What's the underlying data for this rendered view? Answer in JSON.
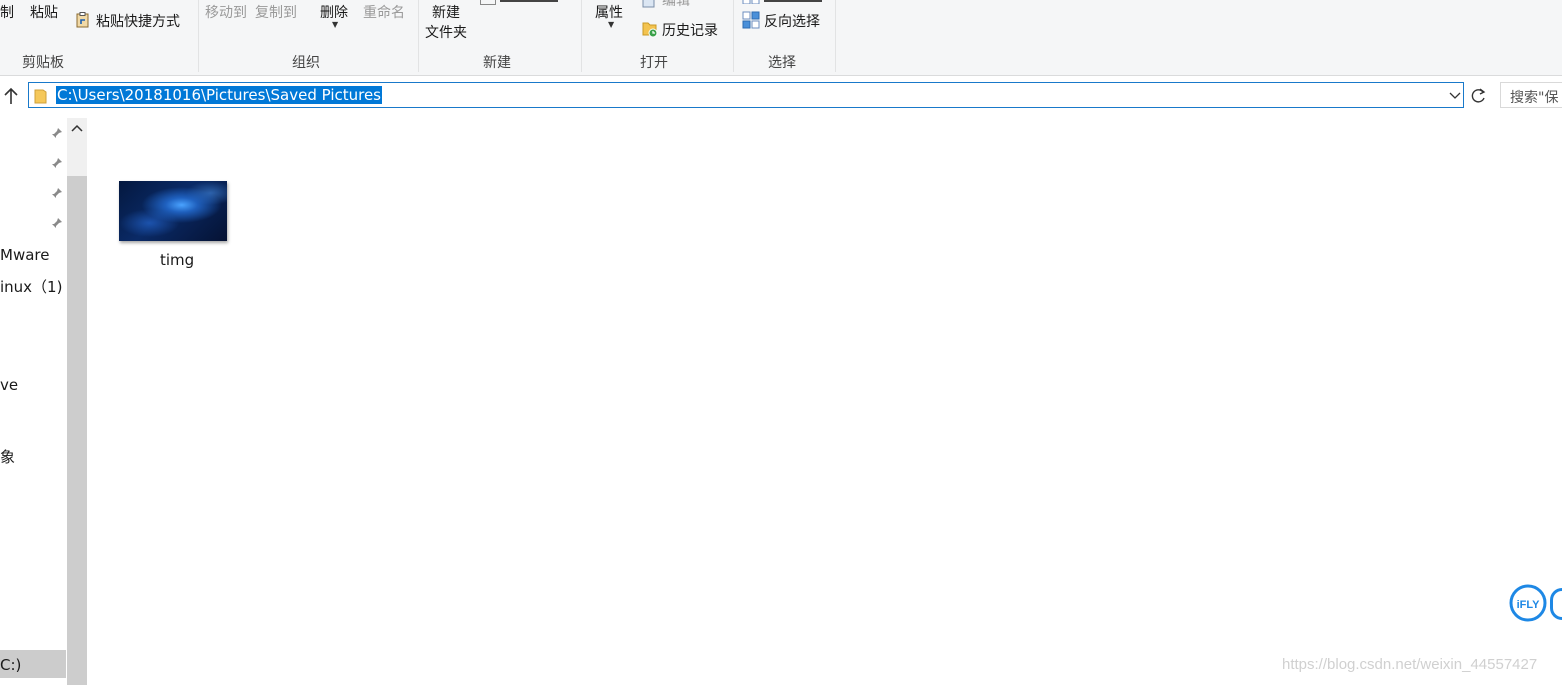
{
  "ribbon": {
    "clipboard": {
      "cut_partial": "制",
      "paste": "粘贴",
      "paste_shortcut": "粘贴快捷方式",
      "group": "剪贴板"
    },
    "organize": {
      "move_to": "移动到",
      "copy_to": "复制到",
      "delete": "删除",
      "rename": "重命名",
      "group": "组织"
    },
    "new": {
      "new_folder_line1": "新建",
      "new_folder_line2": "文件夹",
      "group": "新建"
    },
    "open": {
      "properties": "属性",
      "edit": "编辑",
      "history": "历史记录",
      "group": "打开"
    },
    "select": {
      "invert": "反向选择",
      "group": "选择"
    }
  },
  "address": {
    "path": "C:\\Users\\20181016\\Pictures\\Saved Pictures",
    "search_placeholder": "搜索\"保"
  },
  "nav": {
    "items": [
      "Mware",
      "inux（1)",
      "ve",
      "象",
      "C:)"
    ]
  },
  "files": [
    {
      "name": "timg"
    }
  ],
  "watermark": "https://blog.csdn.net/weixin_44557427",
  "ifly_label": "iFLY"
}
